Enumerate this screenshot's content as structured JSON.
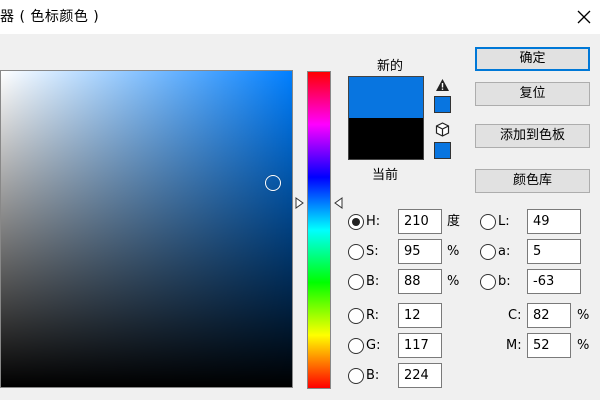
{
  "window": {
    "title": "器 ( 色标颜色 )"
  },
  "preview": {
    "new_label": "新的",
    "current_label": "当前",
    "new_color": "#0875e0",
    "current_color": "#000000"
  },
  "buttons": {
    "ok": "确定",
    "reset": "复位",
    "add_swatch": "添加到色板",
    "color_libraries": "颜色库"
  },
  "hsb": {
    "h": {
      "label": "H:",
      "value": "210",
      "unit": "度",
      "selected": true
    },
    "s": {
      "label": "S:",
      "value": "95",
      "unit": "%"
    },
    "b": {
      "label": "B:",
      "value": "88",
      "unit": "%"
    }
  },
  "rgb": {
    "r": {
      "label": "R:",
      "value": "12"
    },
    "g": {
      "label": "G:",
      "value": "117"
    },
    "b": {
      "label": "B:",
      "value": "224"
    }
  },
  "lab": {
    "l": {
      "label": "L:",
      "value": "49"
    },
    "a": {
      "label": "a:",
      "value": "5"
    },
    "b": {
      "label": "b:",
      "value": "-63"
    }
  },
  "cmyk": {
    "c": {
      "label": "C:",
      "value": "82",
      "unit": "%"
    },
    "m": {
      "label": "M:",
      "value": "52",
      "unit": "%"
    }
  },
  "icons": {
    "close": "close-icon",
    "gamut_warning": "warning-triangle-icon",
    "web_safe": "cube-icon"
  }
}
